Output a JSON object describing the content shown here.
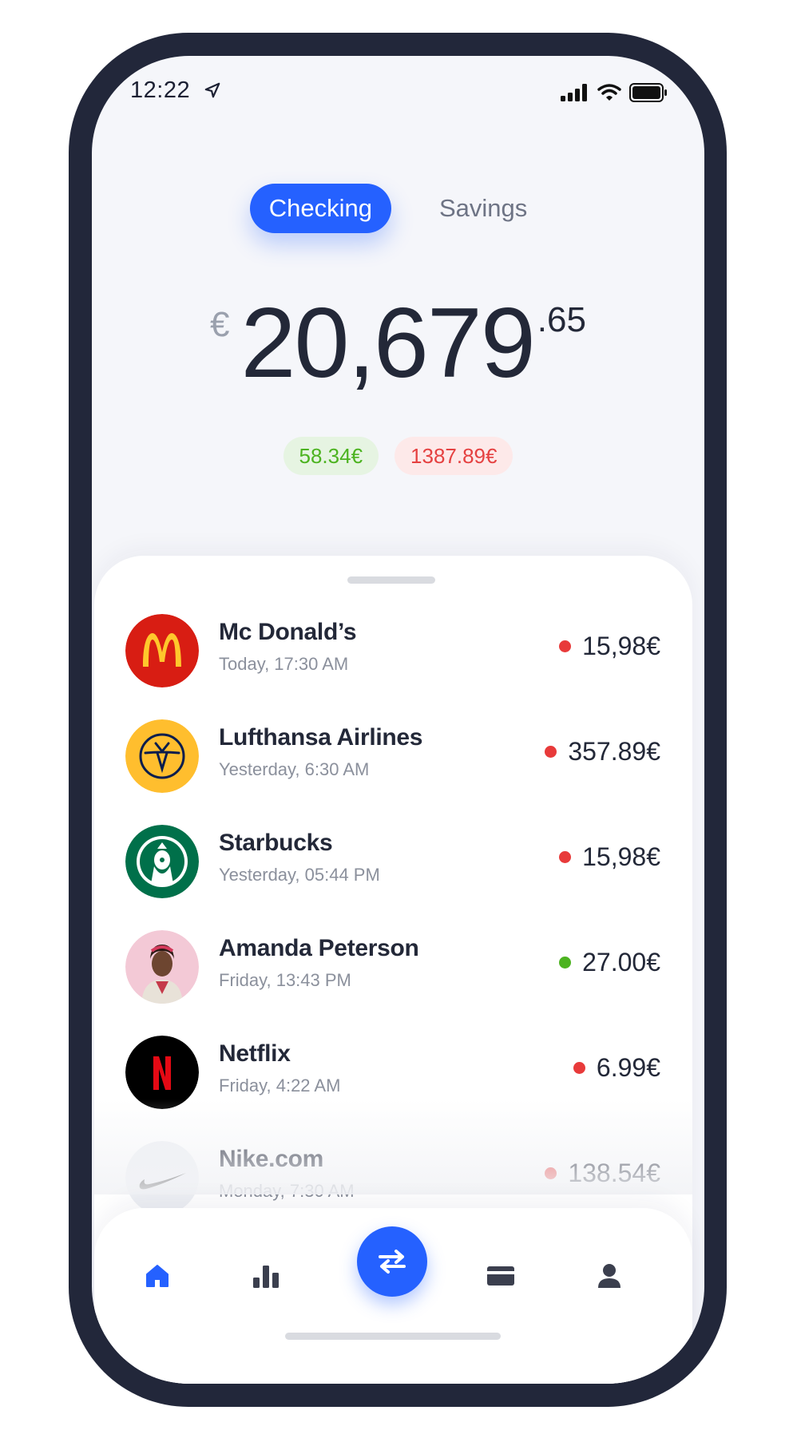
{
  "status": {
    "time": "12:22"
  },
  "tabs": [
    {
      "label": "Checking",
      "active": true
    },
    {
      "label": "Savings",
      "active": false
    }
  ],
  "balance": {
    "currency": "€",
    "whole": "20,679",
    "cents": ".65",
    "income": "58.34€",
    "expense": "1387.89€"
  },
  "transactions": [
    {
      "name": "Mc Donald’s",
      "date": "Today, 17:30 AM",
      "amount": "15,98€",
      "status": "out",
      "logo": "mcdonalds-logo"
    },
    {
      "name": "Lufthansa Airlines",
      "date": "Yesterday, 6:30 AM",
      "amount": "357.89€",
      "status": "out",
      "logo": "lufthansa-logo"
    },
    {
      "name": "Starbucks",
      "date": "Yesterday, 05:44 PM",
      "amount": "15,98€",
      "status": "out",
      "logo": "starbucks-logo"
    },
    {
      "name": "Amanda Peterson",
      "date": "Friday, 13:43 PM",
      "amount": "27.00€",
      "status": "in",
      "logo": "avatar"
    },
    {
      "name": "Netflix",
      "date": "Friday, 4:22 AM",
      "amount": "6.99€",
      "status": "out",
      "logo": "netflix-logo"
    },
    {
      "name": "Nike.com",
      "date": "Monday, 7:30 AM",
      "amount": "138.54€",
      "status": "out",
      "logo": "nike-logo"
    }
  ],
  "nav": [
    "home-icon",
    "stats-icon",
    "transfer-icon",
    "card-icon",
    "profile-icon"
  ],
  "colors": {
    "accent": "#2561ff",
    "positive": "#4cb320",
    "negative": "#e83a3a",
    "frame": "#22273a"
  }
}
